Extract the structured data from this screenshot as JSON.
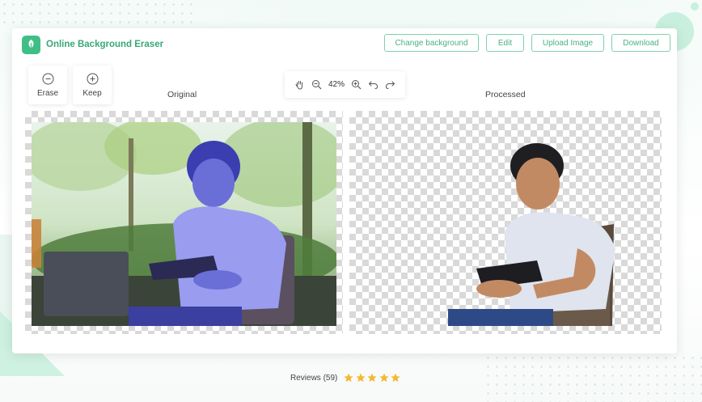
{
  "app": {
    "name": "Online Background Eraser"
  },
  "toolbar": {
    "change_background": "Change background",
    "edit": "Edit",
    "upload_image": "Upload Image",
    "download": "Download"
  },
  "tools": {
    "erase": "Erase",
    "keep": "Keep"
  },
  "view": {
    "zoom": "42%"
  },
  "panels": {
    "original": "Original",
    "processed": "Processed"
  },
  "reviews": {
    "label": "Reviews (59)",
    "rating": 5,
    "star_color": "#f5b82e"
  },
  "colors": {
    "accent": "#3fbf86",
    "button_border": "#7fd1ad"
  }
}
